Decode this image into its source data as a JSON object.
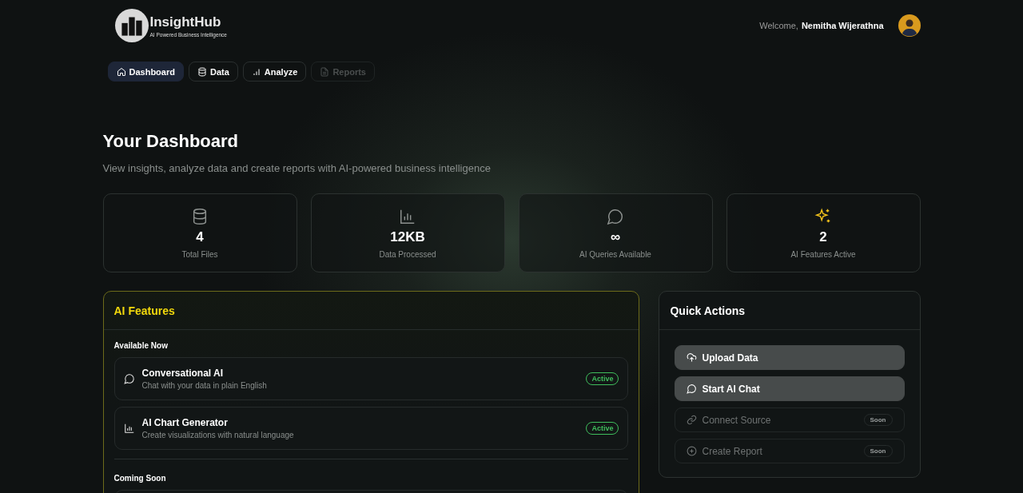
{
  "brand": {
    "name": "InsightHub",
    "tagline": "AI Powered Business Intelligence"
  },
  "user": {
    "greeting": "Welcome,",
    "name": "Nemitha Wijerathna"
  },
  "nav": [
    {
      "label": "Dashboard",
      "selected": true,
      "disabled": false
    },
    {
      "label": "Data",
      "selected": false,
      "disabled": false
    },
    {
      "label": "Analyze",
      "selected": false,
      "disabled": false
    },
    {
      "label": "Reports",
      "selected": false,
      "disabled": true
    }
  ],
  "page": {
    "title": "Your Dashboard",
    "subtitle": "View insights, analyze data and create reports with AI-powered business intelligence"
  },
  "stats": [
    {
      "value": "4",
      "label": "Total Files"
    },
    {
      "value": "12KB",
      "label": "Data Processed"
    },
    {
      "value": "∞",
      "label": "AI Queries Available"
    },
    {
      "value": "2",
      "label": "AI Features Active"
    }
  ],
  "features": {
    "title": "AI Features",
    "sections": [
      {
        "heading": "Available Now",
        "items": [
          {
            "name": "Conversational AI",
            "description": "Chat with your data in plain English",
            "status": "Active"
          },
          {
            "name": "AI Chart Generator",
            "description": "Create visualizations with natural language",
            "status": "Active"
          }
        ]
      },
      {
        "heading": "Coming Soon"
      }
    ]
  },
  "quick_actions": {
    "title": "Quick Actions",
    "items": [
      {
        "label": "Upload Data",
        "disabled": false
      },
      {
        "label": "Start AI Chat",
        "disabled": false
      },
      {
        "label": "Connect Source",
        "disabled": true,
        "badge": "Soon"
      },
      {
        "label": "Create Report",
        "disabled": true,
        "badge": "Soon"
      }
    ]
  }
}
